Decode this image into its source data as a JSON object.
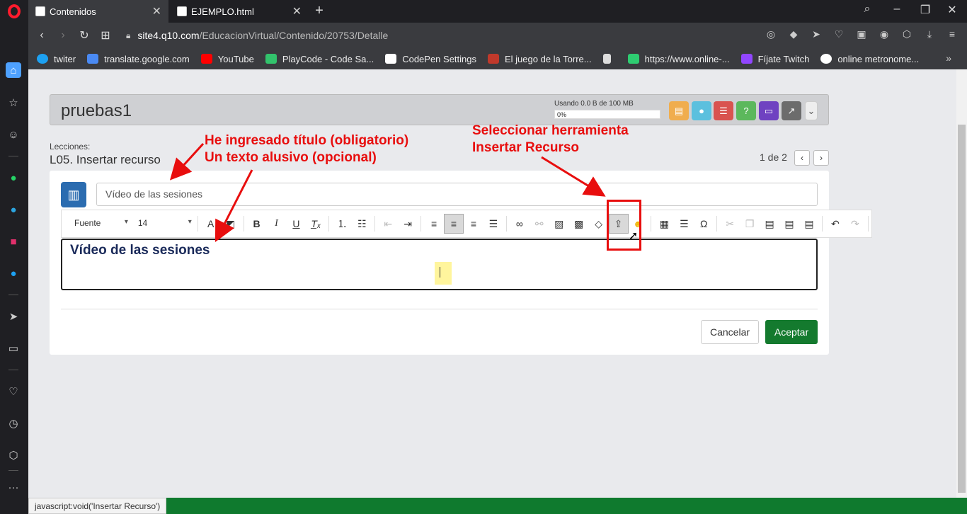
{
  "browser": {
    "tabs": [
      {
        "label": "Contenidos",
        "active": true
      },
      {
        "label": "EJEMPLO.html",
        "active": false
      }
    ],
    "url_host": "site4.q10.com",
    "url_path": "/EducacionVirtual/Contenido/20753/Detalle",
    "bookmarks": [
      {
        "label": "twiter",
        "icon": "twitter-icon",
        "color": "#1da1f2"
      },
      {
        "label": "translate.google.com",
        "icon": "google-translate-icon",
        "color": "#4a8af4"
      },
      {
        "label": "YouTube",
        "icon": "youtube-icon",
        "color": "#ff0000"
      },
      {
        "label": "PlayCode - Code Sa...",
        "icon": "playcode-icon",
        "color": "#32c36c"
      },
      {
        "label": "CodePen Settings",
        "icon": "codepen-icon",
        "color": "#ffffff"
      },
      {
        "label": "El juego de la Torre...",
        "icon": "3w-icon",
        "color": "#c0392b"
      },
      {
        "label": "",
        "icon": "file-icon",
        "color": "#dddddd"
      },
      {
        "label": "https://www.online-...",
        "icon": "online-icon",
        "color": "#2ecc71"
      },
      {
        "label": "Fíjate Twitch",
        "icon": "twitch-icon",
        "color": "#9146ff"
      },
      {
        "label": "online metronome...",
        "icon": "google-icon",
        "color": "#ffffff"
      }
    ],
    "status_url": "javascript:void('Insertar Recurso')"
  },
  "header": {
    "course_title": "pruebas1",
    "storage_label": "Usando 0.0 B de 100 MB",
    "storage_percent": "0%",
    "storage_fraction": 0,
    "buttons": [
      {
        "icon": "briefcase-icon",
        "color": "#f0ad4e"
      },
      {
        "icon": "chat-icon",
        "color": "#5bc0de"
      },
      {
        "icon": "list-icon",
        "color": "#d9534f"
      },
      {
        "icon": "help-icon",
        "color": "#5cb85c"
      },
      {
        "icon": "laptop-icon",
        "color": "#6f42c1"
      },
      {
        "icon": "chart-icon",
        "color": "#6c6c6c"
      }
    ]
  },
  "lesson": {
    "section_label": "Lecciones:",
    "name": "L05. Insertar recurso",
    "pager": "1 de 2"
  },
  "form": {
    "title_value": "Vídeo de las sesiones",
    "font_combo": "Fuente",
    "size_combo": "14",
    "editor_text": "Vídeo de las sesiones",
    "cancel_label": "Cancelar",
    "accept_label": "Aceptar"
  },
  "annotations": {
    "left_line1": "He ingresado título (obligatorio)",
    "left_line2": "Un texto alusivo (opcional)",
    "right_line1": "Seleccionar herramienta",
    "right_line2": "Insertar Recurso",
    "color": "#e80e0e"
  }
}
